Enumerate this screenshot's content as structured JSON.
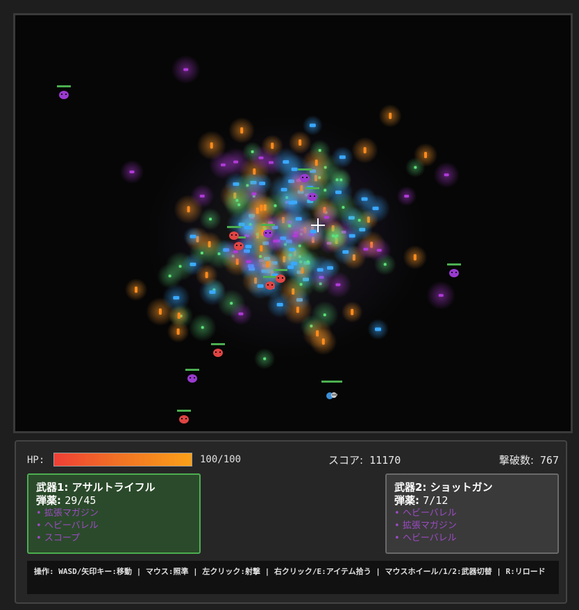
{
  "hud": {
    "hp_label": "HP:",
    "hp_text": "100/100",
    "hp_current": 100,
    "hp_max": 100,
    "score_label": "スコア:",
    "score_value": "11170",
    "kills_label": "撃破数:",
    "kills_value": "767"
  },
  "weapons": [
    {
      "title": "武器1: アサルトライフル",
      "ammo_label": "弾薬:",
      "ammo_value": "29/45",
      "active": true,
      "mods": [
        "拡張マガジン",
        "ヘビーバレル",
        "スコープ"
      ]
    },
    {
      "title": "武器2: ショットガン",
      "ammo_label": "弾薬:",
      "ammo_value": "7/12",
      "active": false,
      "mods": [
        "ヘビーバレル",
        "拡張マガジン",
        "ヘビーバレル"
      ]
    }
  ],
  "controls_text": "操作: WASD/矢印キー:移動 | マウス:照準 | 左クリック:射撃 | 右クリック/E:アイテム拾う | マウスホイール/1/2:武器切替 | R:リロード",
  "colors": {
    "background": "#1e1e1e",
    "game_bg": "#060606",
    "active_border": "#4caf50",
    "active_bg": "#2b4a2b",
    "mod_text": "#9c4bc4",
    "hp_start": "#ef3f36",
    "hp_end": "#fba018",
    "orange_gem": "#ff8a1c",
    "green_gem": "#5ce07a",
    "blue_gem": "#3aa8ff",
    "purple_gem": "#b03ad8",
    "enemy_red": "#e04444",
    "enemy_purple": "#9a3ad0",
    "enemy_hp": "#4caf50"
  },
  "icons": {
    "crosshair": "crosshair-icon",
    "player": "player-icon",
    "enemy": "enemy-icon",
    "pickup": "xp-gem-icon"
  }
}
